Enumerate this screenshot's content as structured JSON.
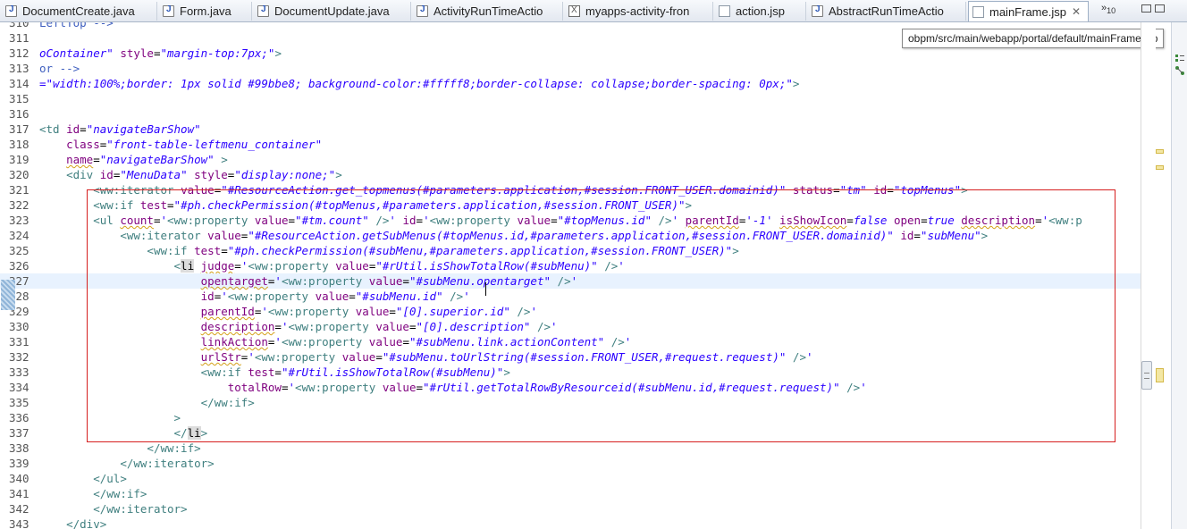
{
  "tabs": [
    {
      "label": "DocumentCreate.java",
      "icon": "java-file-icon"
    },
    {
      "label": "Form.java",
      "icon": "java-file-icon"
    },
    {
      "label": "DocumentUpdate.java",
      "icon": "java-file-icon"
    },
    {
      "label": "ActivityRunTimeActio",
      "icon": "java-file-icon"
    },
    {
      "label": "myapps-activity-fron",
      "icon": "xml-file-icon"
    },
    {
      "label": "action.jsp",
      "icon": "jsp-file-icon"
    },
    {
      "label": "AbstractRunTimeActio",
      "icon": "java-file-icon"
    },
    {
      "label": "mainFrame.jsp",
      "icon": "jsp-file-icon",
      "active": true
    }
  ],
  "tab_close_glyph": "✕",
  "overflow": {
    "arrows": "»",
    "count": "10"
  },
  "tooltip": "obpm/src/main/webapp/portal/default/mainFrame.jsp",
  "colors": {
    "tag": "#3f7f7f",
    "attr": "#7f007f",
    "string": "#2a00ff",
    "comment": "#3f5fbf",
    "highlight_box": "#d61f1f",
    "current_line": "#e8f2fe"
  },
  "lines": [
    {
      "n": "310",
      "segs": [
        [
          "cmt",
          "LeftTop -->"
        ]
      ]
    },
    {
      "n": "311",
      "segs": []
    },
    {
      "n": "312",
      "segs": [
        [
          "str",
          "oContainer\""
        ],
        [
          "plain",
          " "
        ],
        [
          "attr",
          "style"
        ],
        [
          "plain",
          "="
        ],
        [
          "str",
          "\"margin-top:7px;\""
        ],
        [
          "tag",
          ">"
        ]
      ]
    },
    {
      "n": "313",
      "segs": [
        [
          "cmt",
          "or -->"
        ]
      ]
    },
    {
      "n": "314",
      "segs": [
        [
          "str",
          "=\"width:100%;border: 1px solid #99bbe8; background-color:#fffff8;border-collapse: collapse;border-spacing: 0px;\""
        ],
        [
          "tag",
          ">"
        ]
      ]
    },
    {
      "n": "315",
      "segs": []
    },
    {
      "n": "316",
      "segs": []
    },
    {
      "n": "317",
      "segs": [
        [
          "tag",
          "<td "
        ],
        [
          "attr",
          "id"
        ],
        [
          "plain",
          "="
        ],
        [
          "str",
          "\"navigateBarShow\""
        ]
      ]
    },
    {
      "n": "318",
      "segs": [
        [
          "plain",
          "    "
        ],
        [
          "attr",
          "class"
        ],
        [
          "plain",
          "="
        ],
        [
          "str",
          "\"front-table-leftmenu_container\""
        ]
      ]
    },
    {
      "n": "319",
      "segs": [
        [
          "plain",
          "    "
        ],
        [
          "attr",
          "name"
        ],
        [
          "plain",
          "="
        ],
        [
          "str",
          "\"navigateBarShow\""
        ],
        [
          "plain",
          " "
        ],
        [
          "tag",
          ">"
        ]
      ]
    },
    {
      "n": "320",
      "segs": [
        [
          "plain",
          "    "
        ],
        [
          "tag",
          "<div "
        ],
        [
          "attr",
          "id"
        ],
        [
          "plain",
          "="
        ],
        [
          "str",
          "\"MenuData\""
        ],
        [
          "plain",
          " "
        ],
        [
          "attr",
          "style"
        ],
        [
          "plain",
          "="
        ],
        [
          "str",
          "\"display:none;\""
        ],
        [
          "tag",
          ">"
        ]
      ]
    },
    {
      "n": "321",
      "segs": [
        [
          "plain",
          "        "
        ],
        [
          "tag",
          "<ww:iterator "
        ],
        [
          "attr",
          "value"
        ],
        [
          "plain",
          "="
        ],
        [
          "str",
          "\"#ResourceAction.get_topmenus(#parameters.application,#session.FRONT_USER.domainid)\""
        ],
        [
          "plain",
          " "
        ],
        [
          "attr",
          "status"
        ],
        [
          "plain",
          "="
        ],
        [
          "str",
          "\"tm\""
        ],
        [
          "plain",
          " "
        ],
        [
          "attr",
          "id"
        ],
        [
          "plain",
          "="
        ],
        [
          "str",
          "\"topMenus\""
        ],
        [
          "tag",
          ">"
        ]
      ]
    },
    {
      "n": "322",
      "segs": [
        [
          "plain",
          "        "
        ],
        [
          "tag",
          "<ww:if "
        ],
        [
          "attr",
          "test"
        ],
        [
          "plain",
          "="
        ],
        [
          "str",
          "\"#ph.checkPermission(#topMenus,#parameters.application,#session.FRONT_USER)\""
        ],
        [
          "tag",
          ">"
        ]
      ]
    },
    {
      "n": "323",
      "segs": [
        [
          "plain",
          "        "
        ],
        [
          "tag",
          "<ul "
        ],
        [
          "attr",
          "count"
        ],
        [
          "plain",
          "="
        ],
        [
          "str",
          "'"
        ],
        [
          "tag",
          "<ww:property "
        ],
        [
          "attr",
          "value"
        ],
        [
          "plain",
          "="
        ],
        [
          "str",
          "\"#tm.count\""
        ],
        [
          "tag",
          " />"
        ],
        [
          "str",
          "'"
        ],
        [
          "plain",
          " "
        ],
        [
          "attr",
          "id"
        ],
        [
          "plain",
          "="
        ],
        [
          "str",
          "'"
        ],
        [
          "tag",
          "<ww:property "
        ],
        [
          "attr",
          "value"
        ],
        [
          "plain",
          "="
        ],
        [
          "str",
          "\"#topMenus.id\""
        ],
        [
          "tag",
          " />"
        ],
        [
          "str",
          "'"
        ],
        [
          "plain",
          " "
        ],
        [
          "attr",
          "parentId"
        ],
        [
          "plain",
          "="
        ],
        [
          "str",
          "'-1'"
        ],
        [
          "plain",
          " "
        ],
        [
          "attr",
          "isShowIcon"
        ],
        [
          "plain",
          "="
        ],
        [
          "str",
          "false"
        ],
        [
          "plain",
          " "
        ],
        [
          "attr",
          "open"
        ],
        [
          "plain",
          "="
        ],
        [
          "str",
          "true"
        ],
        [
          "plain",
          " "
        ],
        [
          "attr",
          "description"
        ],
        [
          "plain",
          "="
        ],
        [
          "str",
          "'"
        ],
        [
          "tag",
          "<ww:p"
        ]
      ]
    },
    {
      "n": "324",
      "segs": [
        [
          "plain",
          "            "
        ],
        [
          "tag",
          "<ww:iterator "
        ],
        [
          "attr",
          "value"
        ],
        [
          "plain",
          "="
        ],
        [
          "str",
          "\"#ResourceAction.getSubMenus(#topMenus.id,#parameters.application,#session.FRONT_USER.domainid)\""
        ],
        [
          "plain",
          " "
        ],
        [
          "attr",
          "id"
        ],
        [
          "plain",
          "="
        ],
        [
          "str",
          "\"subMenu\""
        ],
        [
          "tag",
          ">"
        ]
      ]
    },
    {
      "n": "325",
      "segs": [
        [
          "plain",
          "                "
        ],
        [
          "tag",
          "<ww:if "
        ],
        [
          "attr",
          "test"
        ],
        [
          "plain",
          "="
        ],
        [
          "str",
          "\"#ph.checkPermission(#subMenu,#parameters.application,#session.FRONT_USER)\""
        ],
        [
          "tag",
          ">"
        ]
      ]
    },
    {
      "n": "326",
      "segs": [
        [
          "plain",
          "                    "
        ],
        [
          "tag",
          "<"
        ],
        [
          "hl",
          "li"
        ],
        [
          "plain",
          " "
        ],
        [
          "attr",
          "judge"
        ],
        [
          "plain",
          "="
        ],
        [
          "str",
          "'"
        ],
        [
          "tag",
          "<ww:property "
        ],
        [
          "attr",
          "value"
        ],
        [
          "plain",
          "="
        ],
        [
          "str",
          "\"#rUtil.isShowTotalRow(#subMenu)\""
        ],
        [
          "tag",
          " />"
        ],
        [
          "str",
          "'"
        ]
      ]
    },
    {
      "n": "327",
      "segs": [
        [
          "plain",
          "                        "
        ],
        [
          "attr",
          "opentarget"
        ],
        [
          "plain",
          "="
        ],
        [
          "str",
          "'"
        ],
        [
          "tag",
          "<ww:property "
        ],
        [
          "attr",
          "value"
        ],
        [
          "plain",
          "="
        ],
        [
          "str",
          "\"#subMenu.opentarget\""
        ],
        [
          "tag",
          " />"
        ],
        [
          "str",
          "'"
        ]
      ],
      "current": true
    },
    {
      "n": "328",
      "segs": [
        [
          "plain",
          "                        "
        ],
        [
          "attr",
          "id"
        ],
        [
          "plain",
          "="
        ],
        [
          "str",
          "'"
        ],
        [
          "tag",
          "<ww:property "
        ],
        [
          "attr",
          "value"
        ],
        [
          "plain",
          "="
        ],
        [
          "str",
          "\"#subMenu.id\""
        ],
        [
          "tag",
          " />"
        ],
        [
          "str",
          "'"
        ]
      ]
    },
    {
      "n": "329",
      "segs": [
        [
          "plain",
          "                        "
        ],
        [
          "attr",
          "parentId"
        ],
        [
          "plain",
          "="
        ],
        [
          "str",
          "'"
        ],
        [
          "tag",
          "<ww:property "
        ],
        [
          "attr",
          "value"
        ],
        [
          "plain",
          "="
        ],
        [
          "str",
          "\"[0].superior.id\""
        ],
        [
          "tag",
          " />"
        ],
        [
          "str",
          "'"
        ]
      ]
    },
    {
      "n": "330",
      "segs": [
        [
          "plain",
          "                        "
        ],
        [
          "attr",
          "description"
        ],
        [
          "plain",
          "="
        ],
        [
          "str",
          "'"
        ],
        [
          "tag",
          "<ww:property "
        ],
        [
          "attr",
          "value"
        ],
        [
          "plain",
          "="
        ],
        [
          "str",
          "\"[0].description\""
        ],
        [
          "tag",
          " />"
        ],
        [
          "str",
          "'"
        ]
      ]
    },
    {
      "n": "331",
      "segs": [
        [
          "plain",
          "                        "
        ],
        [
          "attr",
          "linkAction"
        ],
        [
          "plain",
          "="
        ],
        [
          "str",
          "'"
        ],
        [
          "tag",
          "<ww:property "
        ],
        [
          "attr",
          "value"
        ],
        [
          "plain",
          "="
        ],
        [
          "str",
          "\"#subMenu.link.actionContent\""
        ],
        [
          "tag",
          " />"
        ],
        [
          "str",
          "'"
        ]
      ]
    },
    {
      "n": "332",
      "segs": [
        [
          "plain",
          "                        "
        ],
        [
          "attr",
          "urlStr"
        ],
        [
          "plain",
          "="
        ],
        [
          "str",
          "'"
        ],
        [
          "tag",
          "<ww:property "
        ],
        [
          "attr",
          "value"
        ],
        [
          "plain",
          "="
        ],
        [
          "str",
          "\"#subMenu.toUrlString(#session.FRONT_USER,#request.request)\""
        ],
        [
          "tag",
          " />"
        ],
        [
          "str",
          "'"
        ]
      ]
    },
    {
      "n": "333",
      "segs": [
        [
          "plain",
          "                        "
        ],
        [
          "tag",
          "<ww:if "
        ],
        [
          "attr",
          "test"
        ],
        [
          "plain",
          "="
        ],
        [
          "str",
          "\"#rUtil.isShowTotalRow(#subMenu)\""
        ],
        [
          "tag",
          ">"
        ]
      ]
    },
    {
      "n": "334",
      "segs": [
        [
          "plain",
          "                            "
        ],
        [
          "attr",
          "totalRow"
        ],
        [
          "plain",
          "="
        ],
        [
          "str",
          "'"
        ],
        [
          "tag",
          "<ww:property "
        ],
        [
          "attr",
          "value"
        ],
        [
          "plain",
          "="
        ],
        [
          "str",
          "\"#rUtil.getTotalRowByResourceid(#subMenu.id,#request.request)\""
        ],
        [
          "tag",
          " />"
        ],
        [
          "str",
          "'"
        ]
      ]
    },
    {
      "n": "335",
      "segs": [
        [
          "plain",
          "                        "
        ],
        [
          "tag",
          "</ww:if>"
        ]
      ]
    },
    {
      "n": "336",
      "segs": [
        [
          "plain",
          "                    "
        ],
        [
          "tag",
          ">"
        ]
      ]
    },
    {
      "n": "337",
      "segs": [
        [
          "plain",
          "                    "
        ],
        [
          "tag",
          "</"
        ],
        [
          "hl",
          "li"
        ],
        [
          "tag",
          ">"
        ]
      ]
    },
    {
      "n": "338",
      "segs": [
        [
          "plain",
          "                "
        ],
        [
          "tag",
          "</ww:if>"
        ]
      ]
    },
    {
      "n": "339",
      "segs": [
        [
          "plain",
          "            "
        ],
        [
          "tag",
          "</ww:iterator>"
        ]
      ]
    },
    {
      "n": "340",
      "segs": [
        [
          "plain",
          "        "
        ],
        [
          "tag",
          "</ul>"
        ]
      ]
    },
    {
      "n": "341",
      "segs": [
        [
          "plain",
          "        "
        ],
        [
          "tag",
          "</ww:if>"
        ]
      ]
    },
    {
      "n": "342",
      "segs": [
        [
          "plain",
          "        "
        ],
        [
          "tag",
          "</ww:iterator>"
        ]
      ]
    },
    {
      "n": "343",
      "segs": [
        [
          "plain",
          "    "
        ],
        [
          "tag",
          "</div>"
        ]
      ]
    }
  ]
}
